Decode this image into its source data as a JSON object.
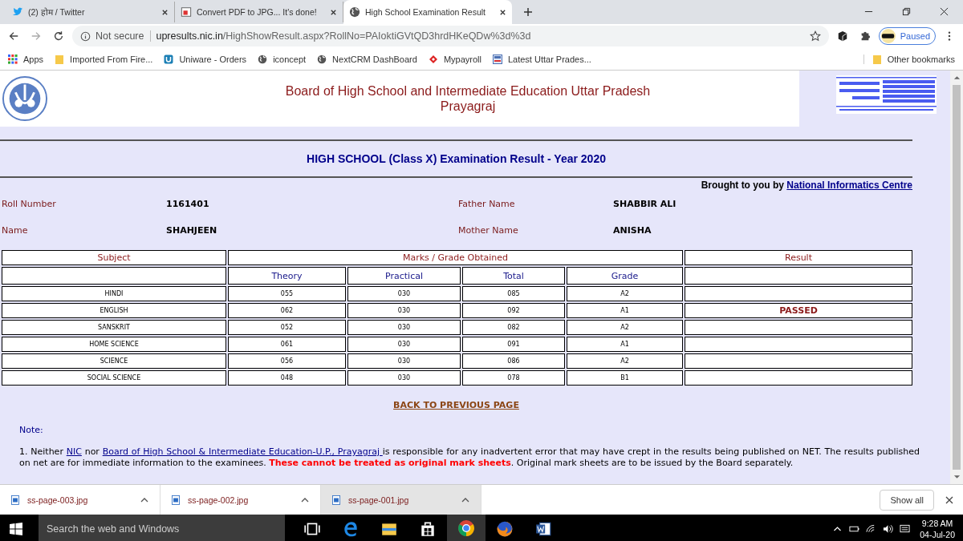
{
  "tabs": [
    {
      "label": "(2) होम / Twitter",
      "kind": "bird",
      "selected": false
    },
    {
      "label": "Convert PDF to JPG... It's done!",
      "kind": "pdf",
      "selected": false
    },
    {
      "label": "High School Examination Result",
      "kind": "globe",
      "selected": true
    }
  ],
  "address": {
    "security": "Not secure",
    "host": "upresults.nic.in",
    "path": "/HighShowResult.aspx?RollNo=PAIoktiGVtQD3hrdHKeQDw%3d%3d"
  },
  "profile": {
    "label": "Paused"
  },
  "bookmarks": [
    {
      "label": "Apps",
      "kind": "grid"
    },
    {
      "label": "Imported From Fire...",
      "kind": "folder"
    },
    {
      "label": "Uniware - Orders",
      "kind": "uni"
    },
    {
      "label": "iconcept",
      "kind": "globe"
    },
    {
      "label": "NextCRM DashBoard",
      "kind": "globe"
    },
    {
      "label": "Mypayroll",
      "kind": "diamond"
    },
    {
      "label": "Latest Uttar Prades...",
      "kind": "news"
    }
  ],
  "other_bookmarks": "Other bookmarks",
  "header": {
    "title_line1": "Board of High School and Intermediate Education Uttar Pradesh",
    "title_line2": "Prayagraj"
  },
  "result_title": "HIGH SCHOOL (Class X)  Examination Result - Year 2020",
  "credit": {
    "text": "Brought to you by",
    "link": "National Informatics Centre"
  },
  "details": [
    {
      "label": "Roll Number",
      "value": "1161401",
      "label2": "Father Name",
      "value2": "SHABBIR ALI"
    },
    {
      "label": "Name",
      "value": "SHAHJEEN",
      "label2": "Mother Name",
      "value2": "ANISHA"
    }
  ],
  "table": {
    "group_headers": [
      "Subject",
      "Marks / Grade Obtained",
      "Result"
    ],
    "columns": [
      "Theory",
      "Practical",
      "Total",
      "Grade"
    ],
    "rows": [
      {
        "subject": "HINDI",
        "theory": "055",
        "practical": "030",
        "total": "085",
        "grade": "A2"
      },
      {
        "subject": "ENGLISH",
        "theory": "062",
        "practical": "030",
        "total": "092",
        "grade": "A1",
        "result": "PASSED"
      },
      {
        "subject": "SANSKRIT",
        "theory": "052",
        "practical": "030",
        "total": "082",
        "grade": "A2"
      },
      {
        "subject": "HOME SCIENCE",
        "theory": "061",
        "practical": "030",
        "total": "091",
        "grade": "A1"
      },
      {
        "subject": "SCIENCE",
        "theory": "056",
        "practical": "030",
        "total": "086",
        "grade": "A2"
      },
      {
        "subject": "SOCIAL SCIENCE",
        "theory": "048",
        "practical": "030",
        "total": "078",
        "grade": "B1"
      }
    ]
  },
  "back_link": "BACK TO PREVIOUS PAGE",
  "note": {
    "heading": "Note:",
    "segments": [
      {
        "kind": "text",
        "text": "1. Neither "
      },
      {
        "kind": "link",
        "text": "NIC"
      },
      {
        "kind": "text",
        "text": " nor "
      },
      {
        "kind": "link",
        "text": "Board of High School & Intermediate Education-U.P., Prayagraj "
      },
      {
        "kind": "text",
        "text": "is responsible for any inadvertent error that may have crept in the results being published on NET. The results published on net are for immediate information to the examinees. "
      },
      {
        "kind": "alert",
        "text": "These cannot be treated as original mark sheets"
      },
      {
        "kind": "text",
        "text": ". Original mark sheets are to be issued by the Board separately."
      }
    ]
  },
  "downloads": [
    {
      "name": "ss-page-003.jpg",
      "selected": false
    },
    {
      "name": "ss-page-002.jpg",
      "selected": false
    },
    {
      "name": "ss-page-001.jpg",
      "selected": true
    }
  ],
  "show_all": "Show all",
  "taskbar": {
    "search_placeholder": "Search the web and Windows",
    "apps": [
      {
        "kind": "taskview",
        "active": false
      },
      {
        "kind": "edge",
        "active": false
      },
      {
        "kind": "explorer",
        "active": false
      },
      {
        "kind": "store",
        "active": false
      },
      {
        "kind": "chrome",
        "active": true
      },
      {
        "kind": "firefox",
        "active": false
      },
      {
        "kind": "word",
        "active": false
      }
    ],
    "time": "9:28 AM",
    "date": "04-Jul-20"
  }
}
